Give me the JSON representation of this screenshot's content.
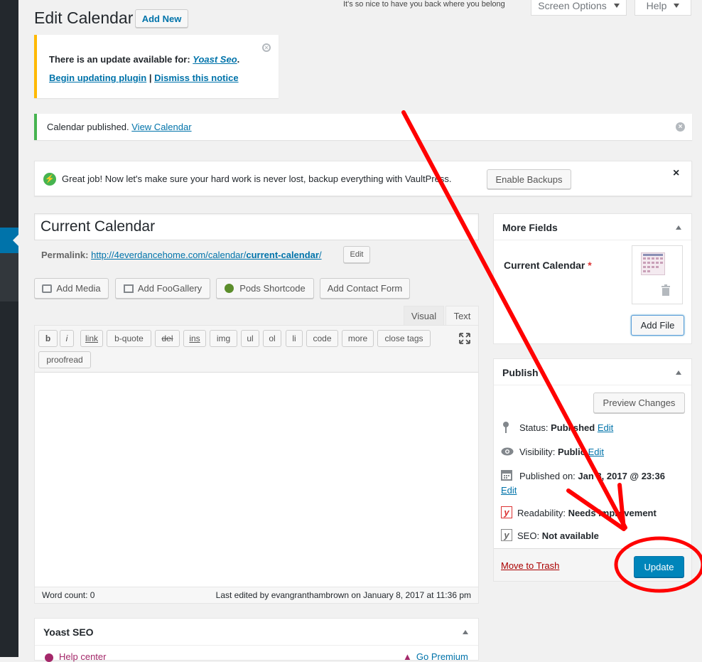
{
  "header": {
    "title": "Edit Calendar",
    "add_new": "Add New",
    "greeting": "It's so nice to have you back where you belong",
    "screen_options": "Screen Options",
    "help": "Help"
  },
  "update_notice": {
    "text": "There is an update available for: ",
    "plugin": "Yoast Seo",
    "period": ".",
    "begin": "Begin updating plugin",
    "sep": "|",
    "dismiss": "Dismiss this notice"
  },
  "published_notice": {
    "text": "Calendar published. ",
    "link": "View Calendar"
  },
  "vault_notice": {
    "text": "Great job! Now let's make sure your hard work is never lost, backup everything with VaultPress.",
    "button": "Enable Backups"
  },
  "editor": {
    "title_value": "Current Calendar",
    "permalink_label": "Permalink:",
    "permalink_base": "http://4everdancehome.com/calendar/",
    "permalink_slug": "current-calendar",
    "permalink_end": "/",
    "permalink_edit": "Edit",
    "media_buttons": [
      "Add Media",
      "Add FooGallery",
      "Pods Shortcode",
      "Add Contact Form"
    ],
    "tab_visual": "Visual",
    "tab_text": "Text",
    "quicktags": [
      "b",
      "i",
      "link",
      "b-quote",
      "del",
      "ins",
      "img",
      "ul",
      "ol",
      "li",
      "code",
      "more",
      "close tags"
    ],
    "proofread": "proofread",
    "word_count": "Word count: 0",
    "last_edited": "Last edited by evangranthambrown on January 8, 2017 at 11:36 pm"
  },
  "yoast": {
    "title": "Yoast SEO",
    "help_center": "Help center",
    "go_premium": "Go Premium"
  },
  "more_fields": {
    "title": "More Fields",
    "field_label": "Current Calendar",
    "required": "*",
    "add_file": "Add File"
  },
  "publish": {
    "title": "Publish",
    "preview": "Preview Changes",
    "status_label": "Status:",
    "status_value": "Published",
    "visibility_label": "Visibility:",
    "visibility_value": "Public",
    "published_on_label": "Published on:",
    "published_on_value": "Jan 8, 2017 @ 23:36",
    "edit": "Edit",
    "readability_label": "Readability:",
    "readability_value": "Needs improvement",
    "seo_label": "SEO:",
    "seo_value": "Not available",
    "trash": "Move to Trash",
    "update": "Update"
  },
  "colors": {
    "accent": "#0073aa",
    "annotation_red": "#ff0000",
    "warning": "#ffb900",
    "success": "#46b450"
  }
}
